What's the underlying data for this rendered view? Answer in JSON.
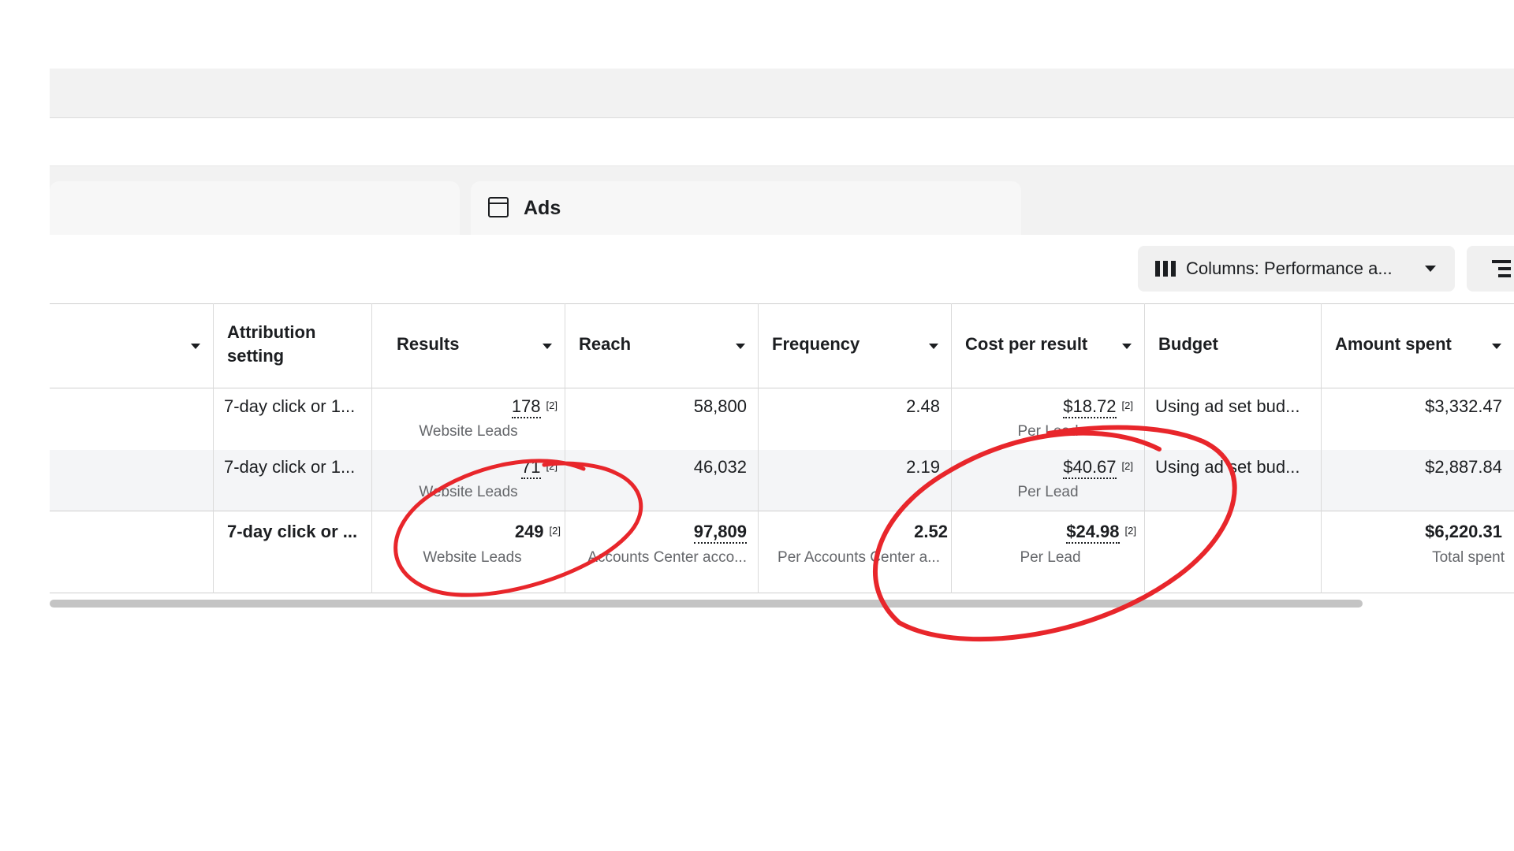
{
  "tabs": {
    "ads_label": "Ads"
  },
  "toolbar": {
    "columns_label": "Columns: Performance a..."
  },
  "table": {
    "headers": {
      "attribution": "Attribution setting",
      "results": "Results",
      "reach": "Reach",
      "frequency": "Frequency",
      "cost_per_result": "Cost per result",
      "budget": "Budget",
      "amount_spent": "Amount spent"
    },
    "footnote": "[2]",
    "rows": [
      {
        "attribution": "7-day click or 1...",
        "results": "178",
        "results_sub": "Website Leads",
        "reach": "58,800",
        "frequency": "2.48",
        "cost": "$18.72",
        "cost_sub": "Per Lead",
        "budget": "Using ad set bud...",
        "spent": "$3,332.47"
      },
      {
        "attribution": "7-day click or 1...",
        "results": "71",
        "results_sub": "Website Leads",
        "reach": "46,032",
        "frequency": "2.19",
        "cost": "$40.67",
        "cost_sub": "Per Lead",
        "budget": "Using ad set bud...",
        "spent": "$2,887.84"
      }
    ],
    "total": {
      "attribution": "7-day click or ...",
      "results": "249",
      "results_sub": "Website Leads",
      "reach": "97,809",
      "reach_sub": "Accounts Center acco...",
      "frequency": "2.52",
      "frequency_sub": "Per Accounts Center a...",
      "cost": "$24.98",
      "cost_sub": "Per Lead",
      "spent": "$6,220.31",
      "spent_sub": "Total spent"
    }
  },
  "annotation_color": "#e8262b"
}
